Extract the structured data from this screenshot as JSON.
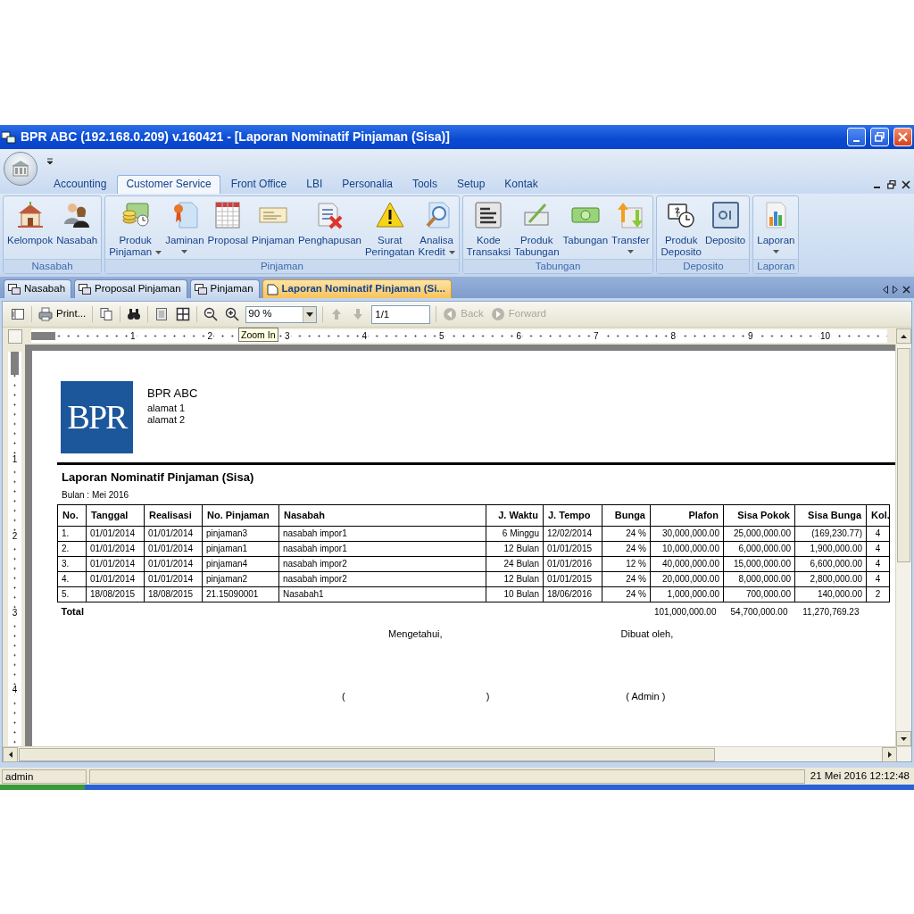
{
  "window": {
    "title": "BPR ABC (192.168.0.209) v.160421 - [Laporan Nominatif Pinjaman (Sisa)]"
  },
  "ribbon": {
    "tabs": [
      {
        "label": "Accounting",
        "selected": false
      },
      {
        "label": "Customer Service",
        "selected": true
      },
      {
        "label": "Front Office",
        "selected": false
      },
      {
        "label": "LBI",
        "selected": false
      },
      {
        "label": "Personalia",
        "selected": false
      },
      {
        "label": "Tools",
        "selected": false
      },
      {
        "label": "Setup",
        "selected": false
      },
      {
        "label": "Kontak",
        "selected": false
      }
    ],
    "groups": [
      {
        "label": "Nasabah",
        "buttons": [
          {
            "lines": [
              "Kelompok"
            ],
            "dropdown": false
          },
          {
            "lines": [
              "Nasabah"
            ],
            "dropdown": false
          }
        ]
      },
      {
        "label": "Pinjaman",
        "buttons": [
          {
            "lines": [
              "Produk",
              "Pinjaman"
            ],
            "dropdown": true
          },
          {
            "lines": [
              "Jaminan"
            ],
            "dropdown": true
          },
          {
            "lines": [
              "Proposal"
            ],
            "dropdown": false
          },
          {
            "lines": [
              "Pinjaman"
            ],
            "dropdown": false
          },
          {
            "lines": [
              "Penghapusan"
            ],
            "dropdown": false
          },
          {
            "lines": [
              "Surat",
              "Peringatan"
            ],
            "dropdown": false
          },
          {
            "lines": [
              "Analisa",
              "Kredit"
            ],
            "dropdown": true
          }
        ]
      },
      {
        "label": "Tabungan",
        "buttons": [
          {
            "lines": [
              "Kode",
              "Transaksi"
            ],
            "dropdown": false
          },
          {
            "lines": [
              "Produk",
              "Tabungan"
            ],
            "dropdown": false
          },
          {
            "lines": [
              "Tabungan"
            ],
            "dropdown": false
          },
          {
            "lines": [
              "Transfer"
            ],
            "dropdown": true
          }
        ]
      },
      {
        "label": "Deposito",
        "buttons": [
          {
            "lines": [
              "Produk",
              "Deposito"
            ],
            "dropdown": false
          },
          {
            "lines": [
              "Deposito"
            ],
            "dropdown": false
          }
        ]
      },
      {
        "label": "Laporan",
        "buttons": [
          {
            "lines": [
              "Laporan"
            ],
            "dropdown": true
          }
        ]
      }
    ]
  },
  "doc_tabs": [
    {
      "label": "Nasabah",
      "selected": false
    },
    {
      "label": "Proposal Pinjaman",
      "selected": false
    },
    {
      "label": "Pinjaman",
      "selected": false
    },
    {
      "label": "Laporan Nominatif Pinjaman (Si...",
      "selected": true
    }
  ],
  "toolbar": {
    "print": "Print...",
    "zoom": "90 %",
    "page": "1/1",
    "back": "Back",
    "forward": "Forward",
    "nav_disabled": true
  },
  "tooltip": "Zoom In",
  "ruler": {
    "h_marks": [
      "1",
      "2",
      "3",
      "4",
      "5",
      "6",
      "7",
      "8",
      "9",
      "10"
    ],
    "v_marks": [
      "1",
      "2",
      "3",
      "4"
    ]
  },
  "report": {
    "logo_text": "BPR",
    "company": "BPR ABC",
    "address": [
      "alamat 1",
      "alamat 2"
    ],
    "title": "Laporan Nominatif Pinjaman (Sisa)",
    "period": "Bulan : Mei 2016",
    "columns": [
      "No.",
      "Tanggal",
      "Realisasi",
      "No. Pinjaman",
      "Nasabah",
      "J. Waktu",
      "J. Tempo",
      "Bunga",
      "Plafon",
      "Sisa Pokok",
      "Sisa Bunga",
      "Kol."
    ],
    "rows": [
      [
        "1.",
        "01/01/2014",
        "01/01/2014",
        "pinjaman3",
        "nasabah impor1",
        "6 Minggu",
        "12/02/2014",
        "24 %",
        "30,000,000.00",
        "25,000,000.00",
        "(169,230.77)",
        "4"
      ],
      [
        "2.",
        "01/01/2014",
        "01/01/2014",
        "pinjaman1",
        "nasabah impor1",
        "12 Bulan",
        "01/01/2015",
        "24 %",
        "10,000,000.00",
        "6,000,000.00",
        "1,900,000.00",
        "4"
      ],
      [
        "3.",
        "01/01/2014",
        "01/01/2014",
        "pinjaman4",
        "nasabah impor2",
        "24 Bulan",
        "01/01/2016",
        "12 %",
        "40,000,000.00",
        "15,000,000.00",
        "6,600,000.00",
        "4"
      ],
      [
        "4.",
        "01/01/2014",
        "01/01/2014",
        "pinjaman2",
        "nasabah impor2",
        "12 Bulan",
        "01/01/2015",
        "24 %",
        "20,000,000.00",
        "8,000,000.00",
        "2,800,000.00",
        "4"
      ],
      [
        "5.",
        "18/08/2015",
        "18/08/2015",
        "21.15090001",
        "Nasabah1",
        "10 Bulan",
        "18/06/2016",
        "24 %",
        "1,000,000.00",
        "700,000.00",
        "140,000.00",
        "2"
      ]
    ],
    "total": {
      "label": "Total",
      "plafon": "101,000,000.00",
      "sisa_pokok": "54,700,000.00",
      "sisa_bunga": "11,270,769.23"
    },
    "signatures": {
      "left_caption": "Mengetahui,",
      "right_caption": "Dibuat oleh,",
      "left_open": "(",
      "left_close": ")",
      "right_name": "( Admin )"
    }
  },
  "status_bar": {
    "user": "admin",
    "datetime": "21 Mei 2016  12:12:48"
  }
}
